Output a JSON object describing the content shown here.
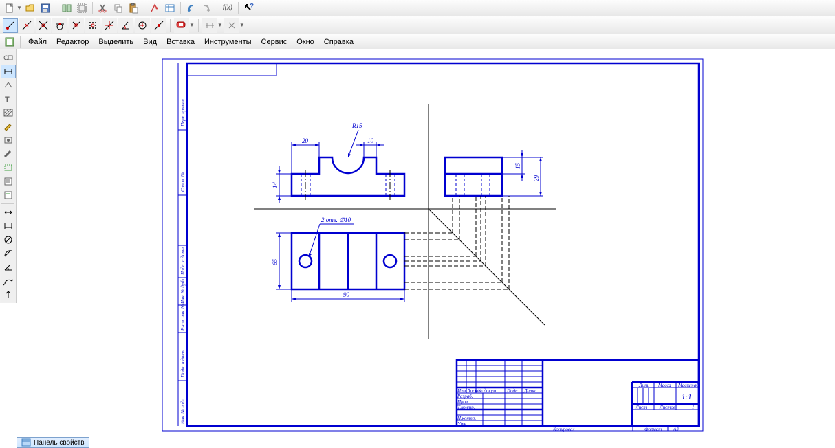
{
  "menu": {
    "file": "Файл",
    "editor": "Редактор",
    "select": "Выделить",
    "view": "Вид",
    "insert": "Вставка",
    "tools": "Инструменты",
    "service": "Сервис",
    "window": "Окно",
    "help": "Справка"
  },
  "bottom": {
    "panel": "Панель свойств"
  },
  "drawing": {
    "dims": {
      "r15": "R15",
      "d20": "20",
      "d10": "10",
      "d14": "14",
      "d15": "15",
      "d29": "29",
      "d65": "65",
      "d90": "90",
      "holes": "2 отв. ∅10"
    },
    "title_block": {
      "izm": "Изм",
      "list": "Лист",
      "ndokum": "№ докум.",
      "podp": "Подп.",
      "data": "Дата",
      "razrab": "Разраб.",
      "prov": "Пров.",
      "tkontr": "Т.контр.",
      "nkontr": "Н.контр.",
      "utv": "Утв.",
      "lit": "Лит.",
      "massa": "Масса",
      "masshtab": "Масштаб",
      "scale": "1:1",
      "list_lbl": "Лист",
      "listov": "Листов",
      "listov_n": "1",
      "kopiroval": "Копировал",
      "format": "Формат",
      "a3": "A3"
    },
    "side_labels": {
      "s1": "Перв. примен.",
      "s2": "Справ. №",
      "s3": "Подп. и дата",
      "s4": "Инв. № дубл.",
      "s5": "Взам. инв. №",
      "s6": "Подп. и дата",
      "s7": "Инв. № подл."
    }
  },
  "toolbar": {
    "fx": "f(x)"
  }
}
